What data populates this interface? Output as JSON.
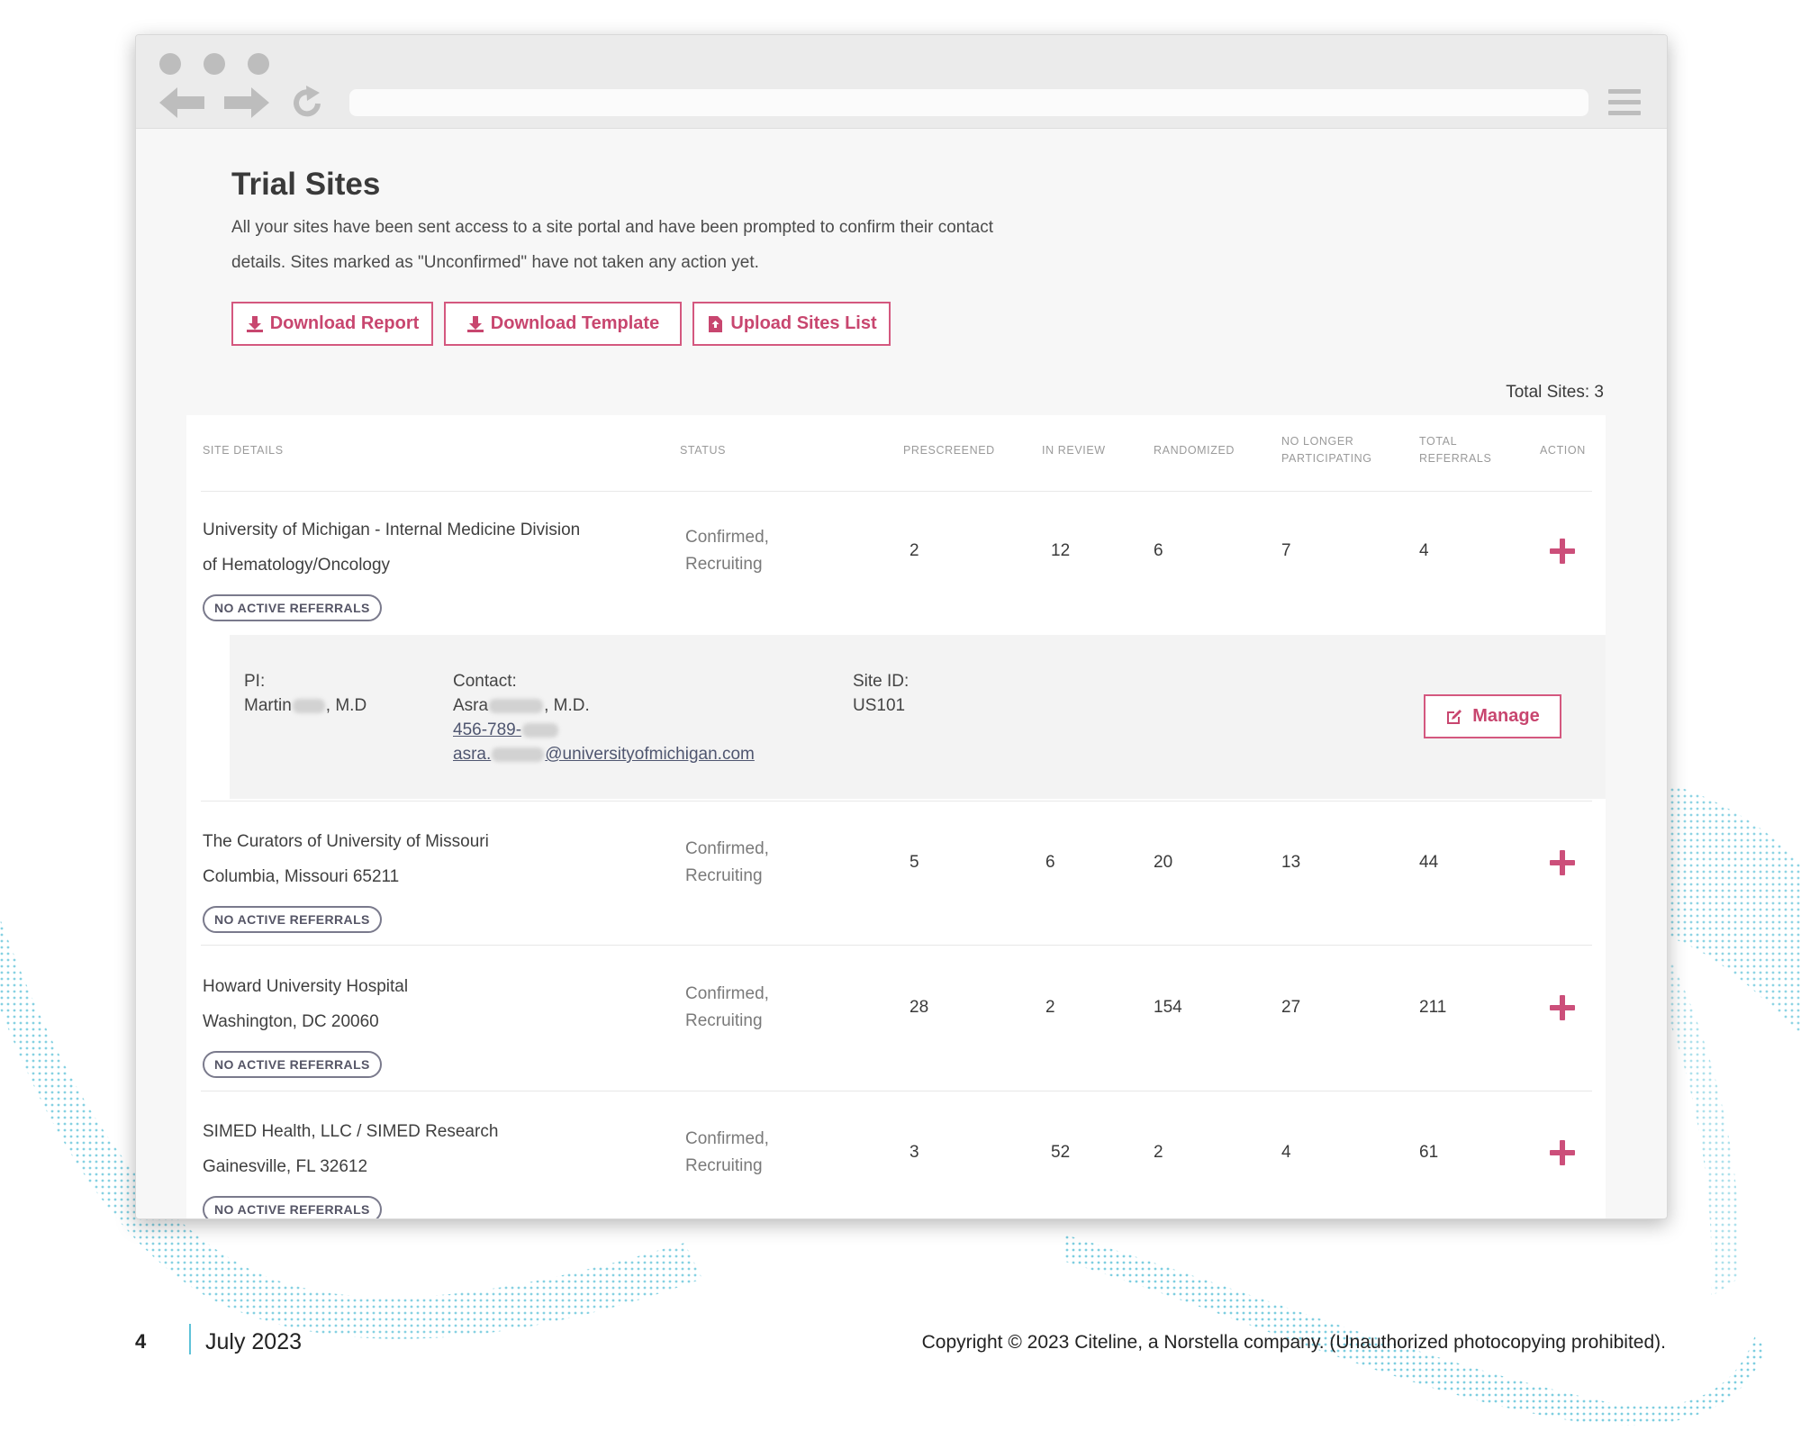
{
  "browser": {
    "icons": [
      "back-arrow-icon",
      "forward-arrow-icon",
      "reload-icon",
      "hamburger-menu-icon"
    ]
  },
  "page": {
    "title": "Trial Sites",
    "description_line1": "All your sites have been sent access to a site portal and have been prompted to confirm their contact",
    "description_line2": "details. Sites marked as \"Unconfirmed\" have not taken any action yet.",
    "total_sites": "Total Sites: 3"
  },
  "toolbar": {
    "download_report": "Download Report",
    "download_template": "Download Template",
    "upload_sites_list": "Upload Sites List"
  },
  "table": {
    "headers": {
      "site_details": "SITE DETAILS",
      "status": "STATUS",
      "prescreened": "PRESCREENED",
      "in_review": "IN REVIEW",
      "randomized": "RANDOMIZED",
      "no_longer_1": "NO LONGER",
      "no_longer_2": "PARTICIPATING",
      "total_1": "TOTAL",
      "total_2": "REFERRALS",
      "action": "ACTION"
    },
    "rows": [
      {
        "name_line1": "University of Michigan - Internal Medicine Division",
        "name_line2": "of Hematology/Oncology",
        "badge": "NO ACTIVE REFERRALS",
        "status_line1": "Confirmed,",
        "status_line2": "Recruiting",
        "prescreened": "2",
        "in_review": "12",
        "randomized": "6",
        "no_longer": "7",
        "total": "4"
      },
      {
        "name_line1": "The Curators of University of Missouri",
        "name_line2": "Columbia, Missouri 65211",
        "badge": "NO ACTIVE REFERRALS",
        "status_line1": "Confirmed,",
        "status_line2": "Recruiting",
        "prescreened": "5",
        "in_review": "6",
        "randomized": "20",
        "no_longer": "13",
        "total": "44"
      },
      {
        "name_line1": "Howard University Hospital",
        "name_line2": "Washington, DC 20060",
        "badge": "NO ACTIVE REFERRALS",
        "status_line1": "Confirmed,",
        "status_line2": "Recruiting",
        "prescreened": "28",
        "in_review": "2",
        "randomized": "154",
        "no_longer": "27",
        "total": "211"
      },
      {
        "name_line1": "SIMED Health, LLC / SIMED Research",
        "name_line2": "Gainesville, FL 32612",
        "badge": "NO ACTIVE REFERRALS",
        "status_line1": "Confirmed,",
        "status_line2": "Recruiting",
        "prescreened": "3",
        "in_review": "52",
        "randomized": "2",
        "no_longer": "4",
        "total": "61"
      }
    ],
    "detail": {
      "pi_label": "PI:",
      "pi_first": "Martin",
      "pi_suffix": ", M.D",
      "contact_label": "Contact:",
      "contact_first": "Asra",
      "contact_suffix": ", M.D.",
      "phone_prefix": "456-789-",
      "email_prefix": "asra.",
      "email_domain": "@universityofmichigan.com",
      "site_id_label": "Site ID:",
      "site_id": "US101",
      "manage": "Manage"
    }
  },
  "footer": {
    "page_number": "4",
    "date": "July 2023",
    "copyright": "Copyright © 2023 Citeline, a Norstella company. (Unauthorized photocopying prohibited)."
  },
  "colors": {
    "accent": "#cc4f7a",
    "wave": "#5ec2d8"
  }
}
